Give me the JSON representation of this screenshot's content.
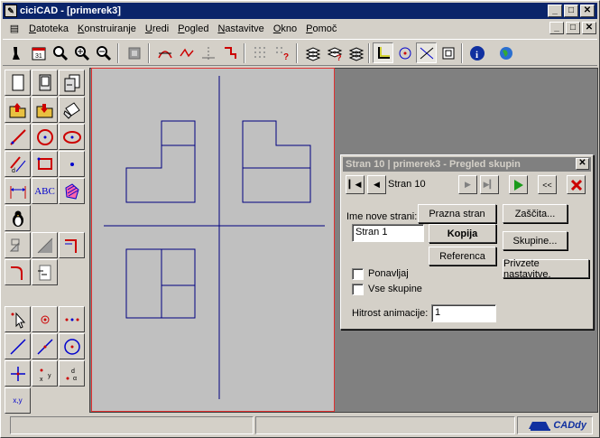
{
  "window": {
    "title": "ciciCAD - [primerek3]"
  },
  "sysbuttons": {
    "minimize": "_",
    "maximize": "□",
    "close": "✕"
  },
  "menu": [
    "Datoteka",
    "Konstruiranje",
    "Uredi",
    "Pogled",
    "Nastavitve",
    "Okno",
    "Pomoč"
  ],
  "dialog": {
    "title": "Stran 10 | primerek3 - Pregled skupin",
    "page_label": "Stran 10",
    "rewind_label": "<<",
    "new_page_label": "Ime nove strani:",
    "new_page_value": "Stran 1",
    "btn_empty": "Prazna stran",
    "btn_copy": "Kopija",
    "btn_reference": "Referenca",
    "btn_protect": "Zaščita...",
    "btn_groups": "Skupine...",
    "btn_apply_settings": "Privzete nastavitve.",
    "chk_repeat": "Ponavljaj",
    "chk_all_groups": "Vse skupine",
    "anim_speed_label": "Hitrost animacije:",
    "anim_speed_value": "1"
  },
  "left_tools": {
    "text_tool": "ABC",
    "coord_tool": "x,y"
  },
  "status": {
    "logo": "CADdy"
  },
  "colors": {
    "titlebar": "#0a246a",
    "sheet_border": "#e03030",
    "drawing_line": "#000080",
    "canvas_bg": "#808080",
    "sheet_bg": "#c0c0c0"
  }
}
